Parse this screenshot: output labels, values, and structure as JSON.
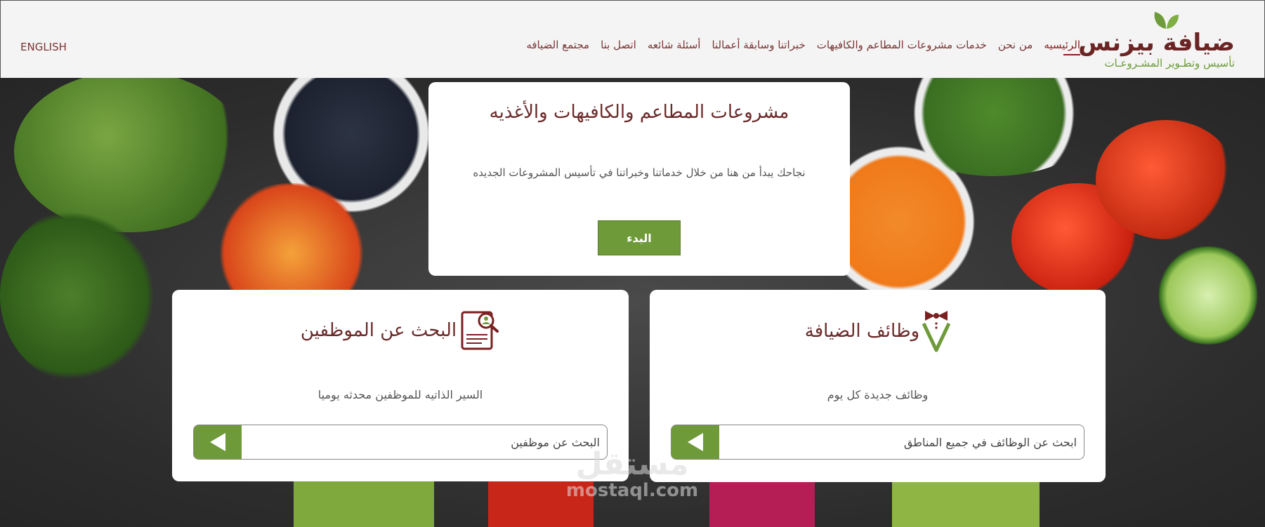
{
  "brand": {
    "name": "ضيافة بيزنس",
    "tagline": "تأسيس وتطـوير المشـروعـات",
    "colors": {
      "primary": "#6b2424",
      "accent": "#6e9c3a"
    }
  },
  "nav": {
    "items": [
      {
        "label": "الرئيسيه",
        "active": true
      },
      {
        "label": "من نحن"
      },
      {
        "label": "خدمات مشروعات المطاعم والكافيهات"
      },
      {
        "label": "خبراتنا وسابقة أعمالنا"
      },
      {
        "label": "أسئلة شائعه"
      },
      {
        "label": "اتصل بنا"
      },
      {
        "label": "مجتمع الضيافه"
      }
    ],
    "language": "ENGLISH"
  },
  "hero": {
    "title": "مشروعات المطاعم والكافيهات والأغذيه",
    "description": "نجاحك يبدأ من هنا من خلال خدماتنا وخبراتنا في تأسيس المشروعات الجديده",
    "cta": "البدء"
  },
  "jobs_card": {
    "title": "وظائف الضيافة",
    "subtitle": "وظائف جديدة كل يوم",
    "search_placeholder": "ابحث عن الوظائف في جميع المناطق",
    "icon": "bowtie-check-icon"
  },
  "staff_card": {
    "title": "البحث عن الموظفين",
    "subtitle": "السير الذاتيه للموظفين محدثه يوميا",
    "search_placeholder": "البحث عن موظفين",
    "icon": "resume-search-icon"
  },
  "watermark": {
    "arabic": "مستقل",
    "latin": "mostaql.com"
  }
}
